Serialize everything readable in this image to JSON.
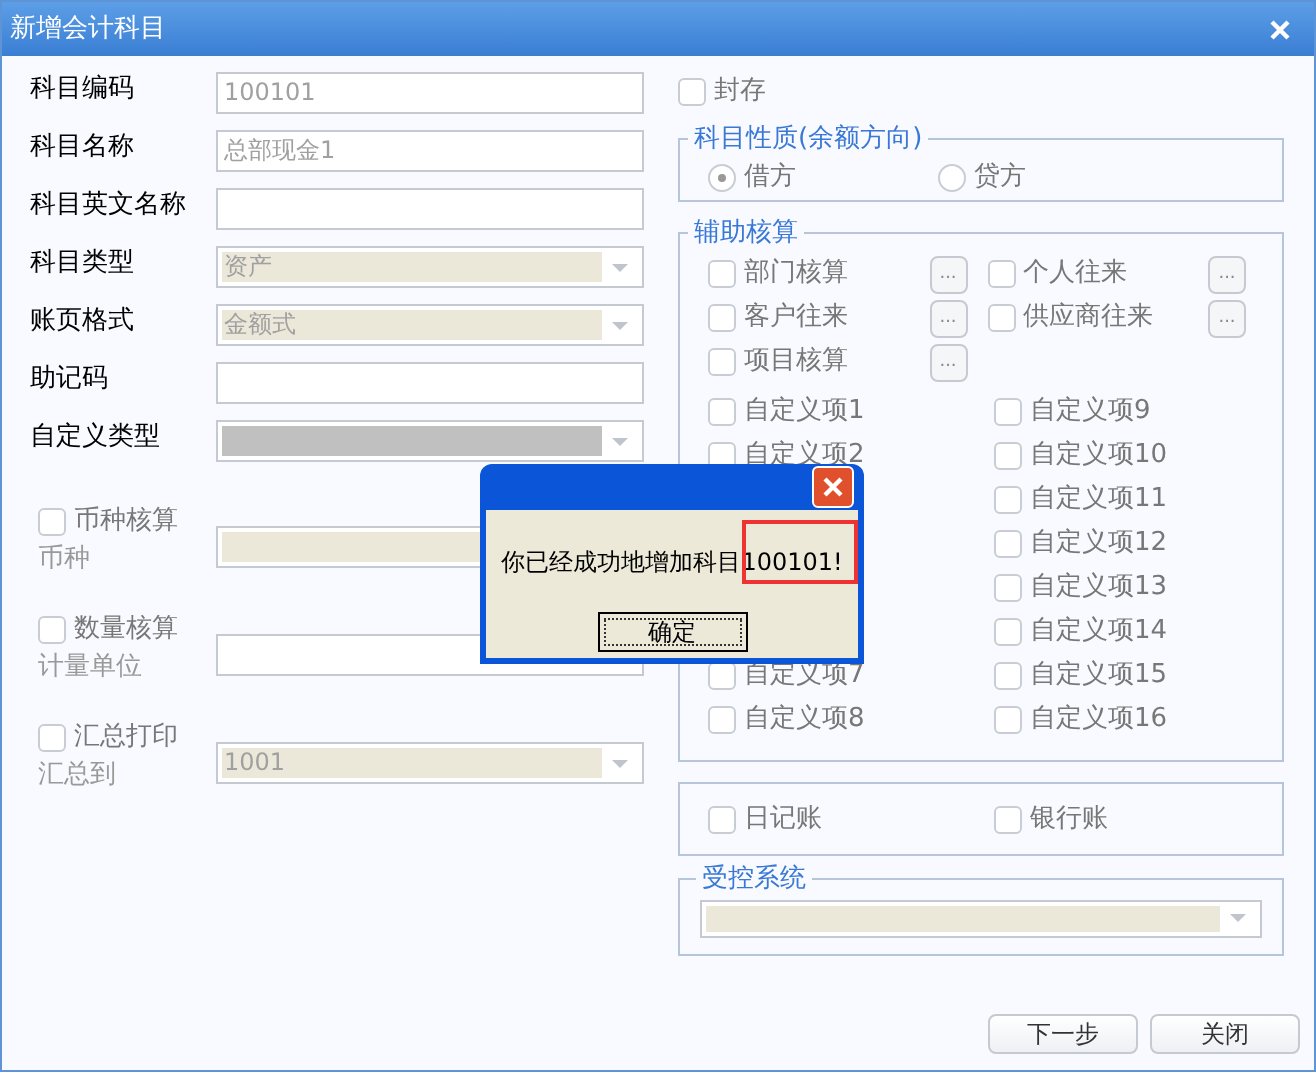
{
  "window": {
    "title": "新增会计科目"
  },
  "fields": [
    {
      "label": "科目编码",
      "kind": "text",
      "value": "100101",
      "disabled": true
    },
    {
      "label": "科目名称",
      "kind": "text",
      "value": "总部现金1",
      "disabled": true
    },
    {
      "label": "科目英文名称",
      "kind": "text"
    },
    {
      "label": "科目类型",
      "kind": "select",
      "value": "资产",
      "disabled": true
    },
    {
      "label": "账页格式",
      "kind": "select",
      "value": "金额式",
      "disabled": true
    },
    {
      "label": "助记码",
      "kind": "text"
    },
    {
      "label": "自定义类型",
      "kind": "select"
    }
  ],
  "options": [
    {
      "label": "币种核算",
      "checked": false,
      "field": {
        "label": "币种",
        "kind": "select",
        "disabled": true
      }
    },
    {
      "label": "数量核算",
      "checked": false,
      "field": {
        "label": "计量单位",
        "kind": "text"
      }
    },
    {
      "label": "汇总打印",
      "checked": false,
      "field": {
        "label": "汇总到",
        "kind": "select",
        "value": "1001",
        "disabled": true
      }
    }
  ],
  "sealed": {
    "label": "封存",
    "checked": false
  },
  "balance_direction": {
    "title": "科目性质(余额方向)",
    "options": [
      {
        "label": "借方",
        "selected": true
      },
      {
        "label": "贷方",
        "selected": false
      }
    ]
  },
  "auxiliary": {
    "title": "辅助核算",
    "items": [
      {
        "label": "部门核算",
        "checked": false,
        "browse": "..."
      },
      {
        "label": "个人往来",
        "checked": false,
        "browse": "..."
      },
      {
        "label": "客户往来",
        "checked": false,
        "browse": "..."
      },
      {
        "label": "供应商往来",
        "checked": false,
        "browse": "..."
      },
      {
        "label": "项目核算",
        "checked": false,
        "browse": "..."
      }
    ],
    "custom_left": [
      {
        "label": "自定义项1",
        "checked": false
      },
      {
        "label": "自定义项2",
        "checked": false
      },
      {
        "label": "自定义项7",
        "checked": false
      },
      {
        "label": "自定义项8",
        "checked": false
      }
    ],
    "custom_right": [
      {
        "label": "自定义项9",
        "checked": false
      },
      {
        "label": "自定义项10",
        "checked": false
      },
      {
        "label": "自定义项11",
        "checked": false
      },
      {
        "label": "自定义项12",
        "checked": false
      },
      {
        "label": "自定义项13",
        "checked": false
      },
      {
        "label": "自定义项14",
        "checked": false
      },
      {
        "label": "自定义项15",
        "checked": false
      },
      {
        "label": "自定义项16",
        "checked": false
      }
    ]
  },
  "books": [
    {
      "label": "日记账",
      "checked": false
    },
    {
      "label": "银行账",
      "checked": false
    }
  ],
  "controlled_system": {
    "title": "受控系统"
  },
  "buttons": [
    "下一步",
    "关闭"
  ],
  "message_box": {
    "text": "你已经成功地增加科目100101!",
    "ok": "确定"
  }
}
